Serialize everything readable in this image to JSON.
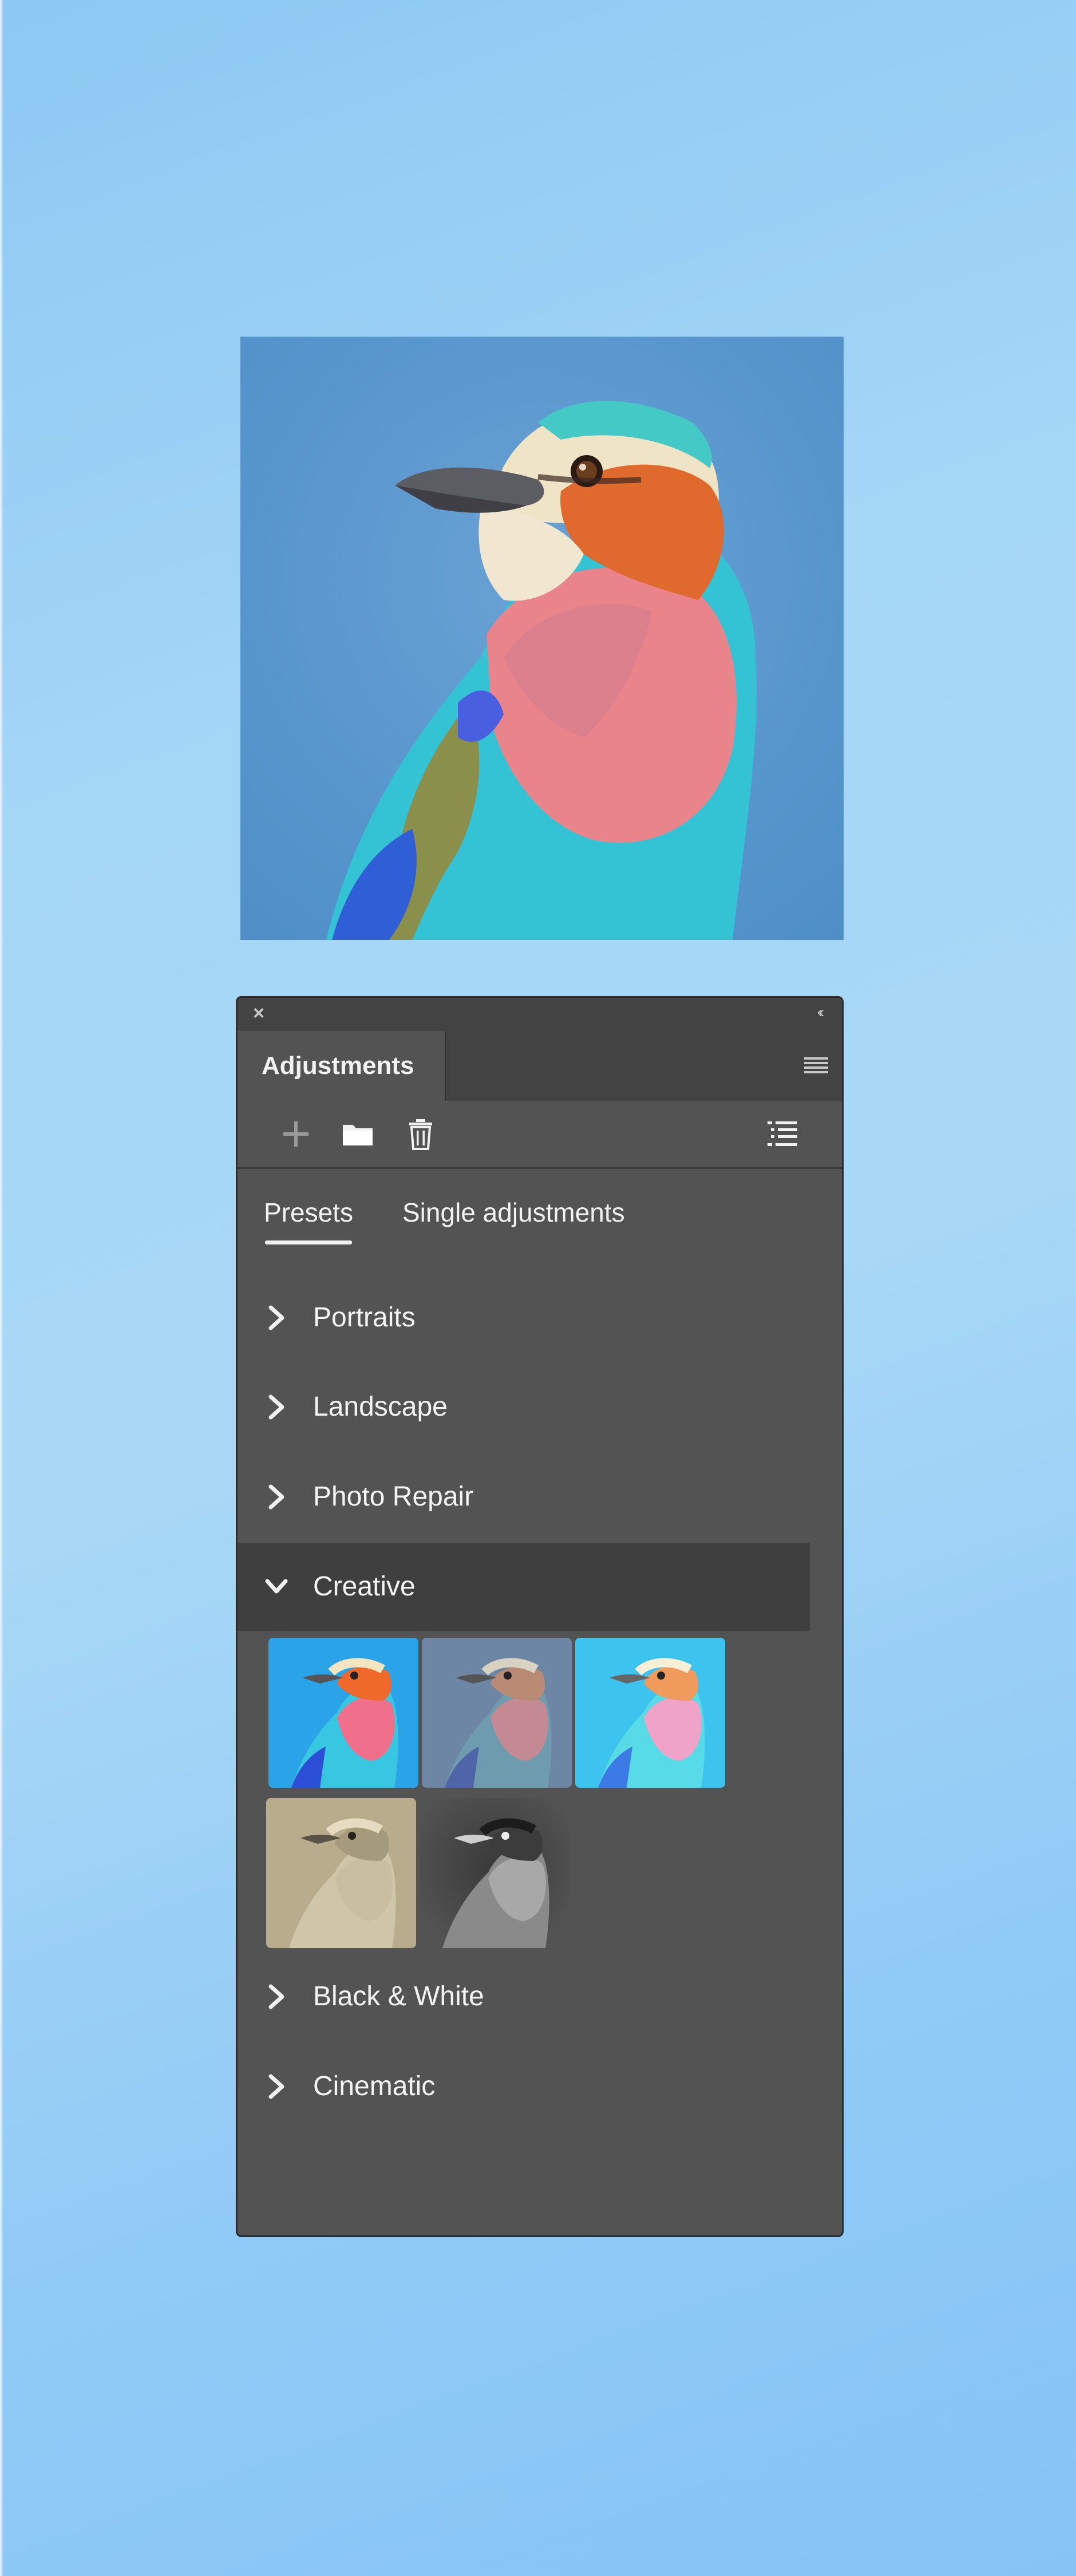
{
  "panel": {
    "close_icon": "close-icon",
    "collapse_icon": "double-chevron-left-icon",
    "title": "Adjustments",
    "menu_icon": "panel-menu-icon"
  },
  "toolbar": {
    "add_icon": "plus-icon",
    "folder_icon": "folder-icon",
    "delete_icon": "trash-icon",
    "list_icon": "list-view-icon"
  },
  "subtabs": {
    "presets": "Presets",
    "single": "Single adjustments"
  },
  "categories": [
    {
      "label": "Portraits",
      "expanded": false
    },
    {
      "label": "Landscape",
      "expanded": false
    },
    {
      "label": "Photo Repair",
      "expanded": false
    },
    {
      "label": "Creative",
      "expanded": true
    },
    {
      "label": "Black & White",
      "expanded": false
    },
    {
      "label": "Cinematic",
      "expanded": false
    }
  ],
  "creative_presets": [
    {
      "style": "vivid"
    },
    {
      "style": "muted"
    },
    {
      "style": "bright"
    },
    {
      "style": "sepia"
    },
    {
      "style": "black-and-white"
    }
  ],
  "colors": {
    "panel_bg": "#535353",
    "tab_bar_bg": "#434343",
    "expanded_row_bg": "#3f3f3f",
    "text": "#f2f2f2"
  }
}
